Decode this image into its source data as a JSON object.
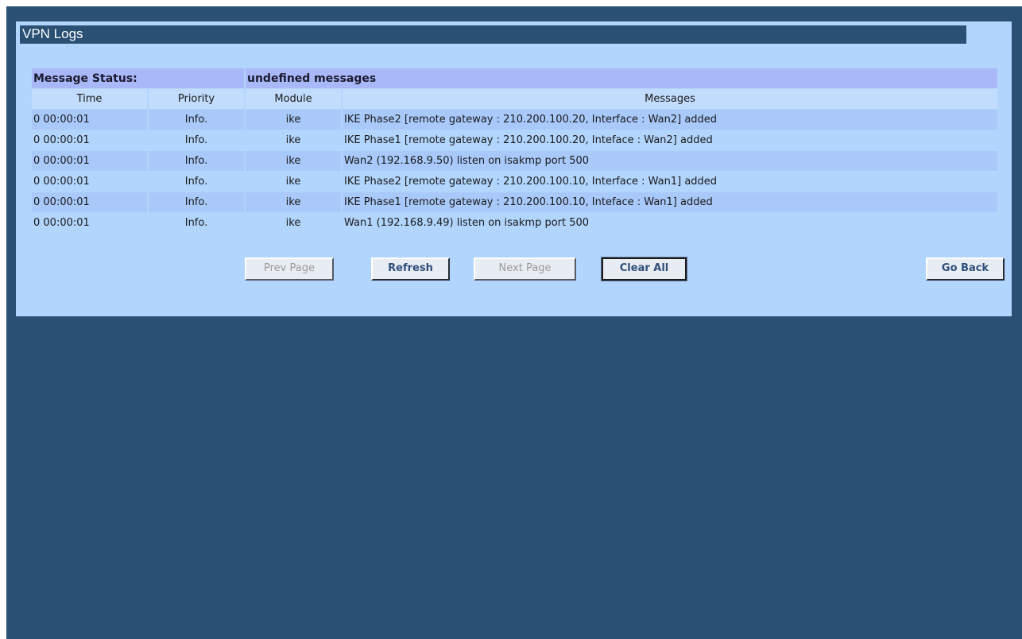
{
  "page": {
    "title": "VPN Logs"
  },
  "status": {
    "label": "Message Status:",
    "value": "undefined messages"
  },
  "table": {
    "columns": [
      "Time",
      "Priority",
      "Module",
      "Messages"
    ],
    "rows": [
      {
        "time": "0 00:00:01",
        "priority": "Info.",
        "module": "ike",
        "message": "IKE Phase2 [remote gateway : 210.200.100.20, Interface : Wan2] added"
      },
      {
        "time": "0 00:00:01",
        "priority": "Info.",
        "module": "ike",
        "message": "IKE Phase1 [remote gateway : 210.200.100.20, Inteface : Wan2] added"
      },
      {
        "time": "0 00:00:01",
        "priority": "Info.",
        "module": "ike",
        "message": "Wan2 (192.168.9.50) listen on isakmp port 500"
      },
      {
        "time": "0 00:00:01",
        "priority": "Info.",
        "module": "ike",
        "message": "IKE Phase2 [remote gateway : 210.200.100.10, Interface : Wan1] added"
      },
      {
        "time": "0 00:00:01",
        "priority": "Info.",
        "module": "ike",
        "message": "IKE Phase1 [remote gateway : 210.200.100.10, Inteface : Wan1] added"
      },
      {
        "time": "0 00:00:01",
        "priority": "Info.",
        "module": "ike",
        "message": "Wan1 (192.168.9.49) listen on isakmp port 500"
      }
    ]
  },
  "buttons": {
    "prev_page": "Prev Page",
    "refresh": "Refresh",
    "next_page": "Next Page",
    "clear_all": "Clear All",
    "go_back": "Go Back"
  },
  "colors": {
    "background": "#2a5174",
    "panel": "#b2d5fd",
    "status_bar": "#a9b8f8",
    "alt_row": "#a9c9fb"
  }
}
